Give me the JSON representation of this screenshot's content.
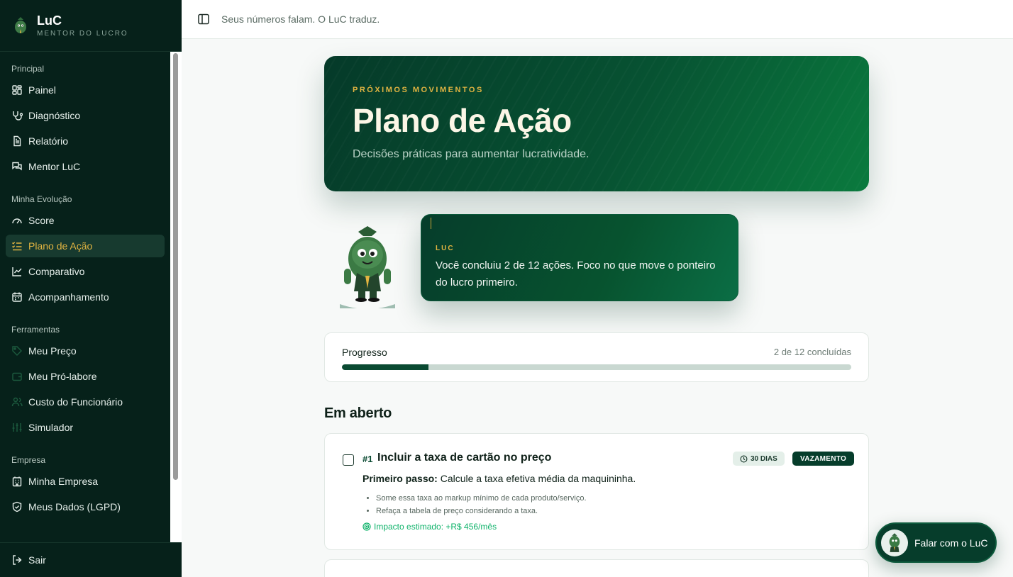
{
  "brand": {
    "name": "LuC",
    "subtitle": "MENTOR DO LUCRO"
  },
  "topbar": {
    "tagline": "Seus números falam. O LuC traduz."
  },
  "sidebar": {
    "groups": [
      {
        "label": "Principal",
        "items": [
          {
            "label": "Painel",
            "icon": "grid-icon"
          },
          {
            "label": "Diagnóstico",
            "icon": "stethoscope-icon"
          },
          {
            "label": "Relatório",
            "icon": "document-icon"
          },
          {
            "label": "Mentor LuC",
            "icon": "chat-icon"
          }
        ]
      },
      {
        "label": "Minha Evolução",
        "items": [
          {
            "label": "Score",
            "icon": "gauge-icon"
          },
          {
            "label": "Plano de Ação",
            "icon": "checklist-icon",
            "active": true
          },
          {
            "label": "Comparativo",
            "icon": "line-chart-icon"
          },
          {
            "label": "Acompanhamento",
            "icon": "calendar-icon"
          }
        ]
      },
      {
        "label": "Ferramentas",
        "items": [
          {
            "label": "Meu Preço",
            "icon": "tag-icon"
          },
          {
            "label": "Meu Pró-labore",
            "icon": "wallet-icon"
          },
          {
            "label": "Custo do Funcionário",
            "icon": "users-icon"
          },
          {
            "label": "Simulador",
            "icon": "sliders-icon"
          }
        ]
      },
      {
        "label": "Empresa",
        "items": [
          {
            "label": "Minha Empresa",
            "icon": "building-icon"
          },
          {
            "label": "Meus Dados (LGPD)",
            "icon": "shield-icon"
          }
        ]
      }
    ],
    "logout": "Sair"
  },
  "hero": {
    "kicker": "PRÓXIMOS MOVIMENTOS",
    "title": "Plano de Ação",
    "subtitle": "Decisões práticas para aumentar lucratividade."
  },
  "mentor": {
    "name": "LUC",
    "message": "Você concluiu 2 de 12 ações. Foco no que move o ponteiro do lucro primeiro."
  },
  "progress": {
    "label": "Progresso",
    "count_text": "2 de 12 concluídas",
    "fraction": 0.17
  },
  "section": {
    "title": "Em aberto"
  },
  "action": {
    "number": "#1",
    "title": "Incluir a taxa de cartão no preço",
    "days_badge": "30 DIAS",
    "type_badge": "VAZAMENTO",
    "first_step_label": "Primeiro passo:",
    "first_step_text": " Calcule a taxa efetiva média da maquininha.",
    "bullets": [
      "Some essa taxa ao markup mínimo de cada produto/serviço.",
      "Refaça a tabela de preço considerando a taxa."
    ],
    "impact": "Impacto estimado: +R$ 456/mês"
  },
  "chat": {
    "label": "Falar com o LuC"
  },
  "colors": {
    "accent_gold": "#e2b441",
    "brand_green": "#063d2b",
    "impact_green": "#10b36b"
  }
}
